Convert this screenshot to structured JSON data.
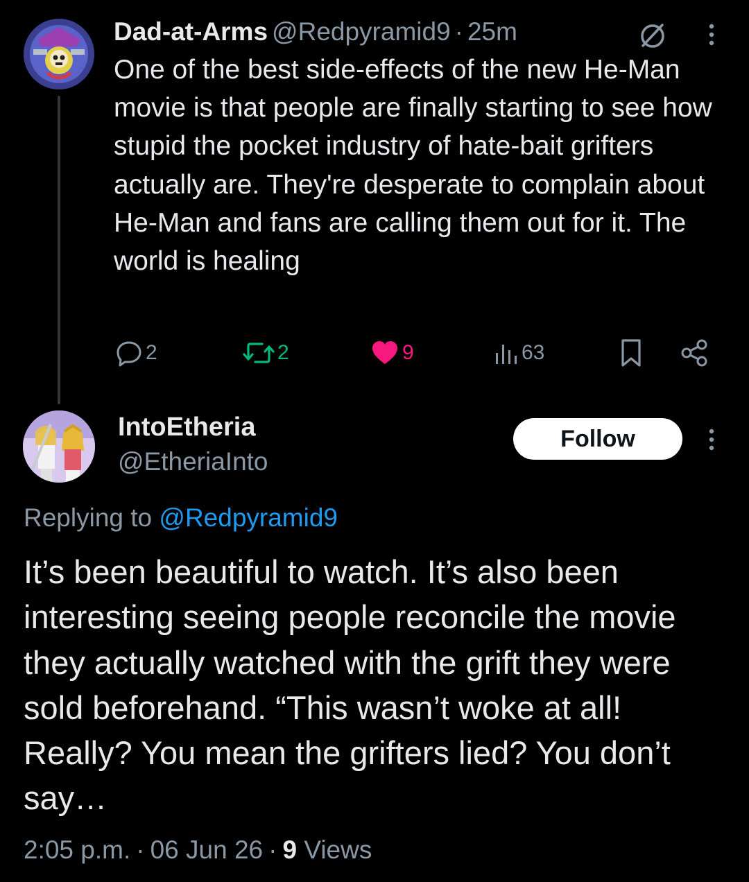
{
  "colors": {
    "background": "#000000",
    "text": "#e7e9ea",
    "secondary": "#8b98a5",
    "link": "#1d9bf0",
    "retweet": "#00ba7c",
    "like": "#f91880"
  },
  "tweet": {
    "author_name": "Dad-at-Arms",
    "author_handle": "@Redpyramid9",
    "separator": "·",
    "time": "25m",
    "text": "One of the best side-effects of the new He-Man movie is that people are finally starting to see how stupid the pocket industry of hate-bait grifters actually are. They're desperate to complain about He-Man and fans are calling them out for it. The world is healing",
    "icons": [
      "avatar",
      "no-entry-icon",
      "more-icon",
      "reply-icon",
      "retweet-icon",
      "heart-icon",
      "views-icon",
      "bookmark-icon",
      "share-icon"
    ],
    "actions": {
      "replies": "2",
      "retweets": "2",
      "likes": "9",
      "views": "63"
    }
  },
  "reply": {
    "author_name": "IntoEtheria",
    "author_handle": "@EtheriaInto",
    "follow_label": "Follow",
    "replying_prefix": "Replying to",
    "replying_handle": "@Redpyramid9",
    "text": "It’s been beautiful to watch. It’s also been interesting seeing people reconcile the movie they actually watched with the grift they were sold beforehand. “This wasn’t woke at all! Really? You mean the grifters lied? You don’t say…",
    "time": "2:05 p.m.",
    "date": "06 Jun 26",
    "separator": "·",
    "views_count": "9",
    "views_label": "Views"
  }
}
